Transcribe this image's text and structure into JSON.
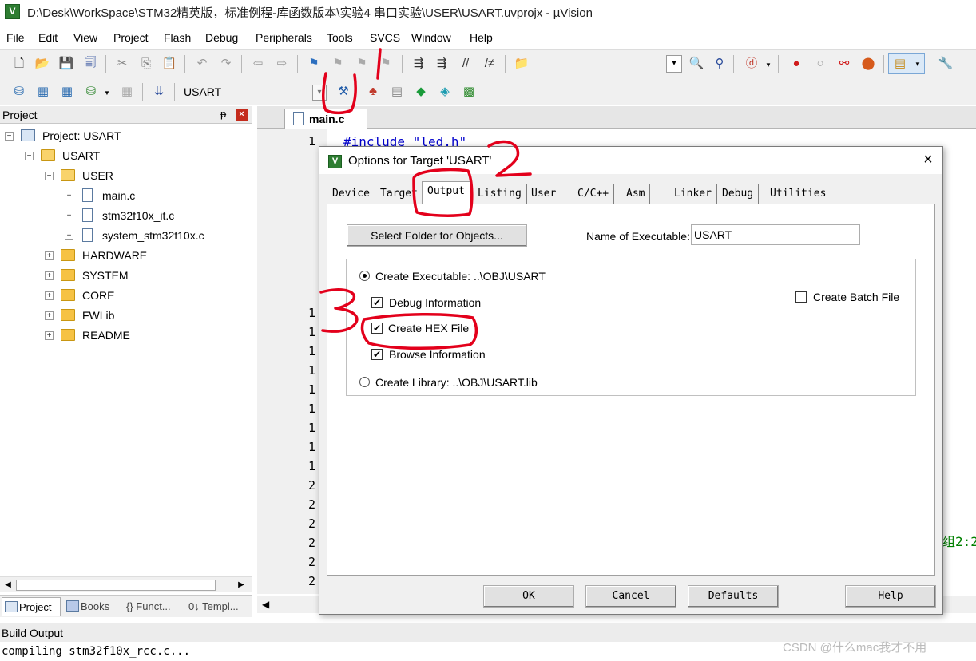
{
  "window": {
    "title": "D:\\Desk\\WorkSpace\\STM32精英版，标准例程-库函数版本\\实验4 串口实验\\USER\\USART.uvprojx - µVision",
    "icon": "uvision-app-icon"
  },
  "menu": [
    "File",
    "Edit",
    "View",
    "Project",
    "Flash",
    "Debug",
    "Peripherals",
    "Tools",
    "SVCS",
    "Window",
    "Help"
  ],
  "toolbar2": {
    "target": "USART"
  },
  "project_panel": {
    "title": "Project",
    "pin": "ᵽ",
    "close": "×",
    "tree": {
      "root": "Project: USART",
      "target": "USART",
      "group_open": "USER",
      "user_files": [
        "main.c",
        "stm32f10x_it.c",
        "system_stm32f10x.c"
      ],
      "groups": [
        "HARDWARE",
        "SYSTEM",
        "CORE",
        "FWLib",
        "README"
      ]
    },
    "tabs": [
      "Project",
      "Books",
      "{} Funct...",
      "0↓ Templ..."
    ]
  },
  "editor": {
    "tab": "main.c",
    "code_line_1": "#include \"led.h\"",
    "side_fragment": "组2:2",
    "line_numbers": [
      "1",
      "1",
      "1",
      "1",
      "1",
      "1",
      "1",
      "1",
      "1",
      "2",
      "2",
      "2",
      "2",
      "2",
      "2"
    ],
    "line_numbers_first": "1"
  },
  "build_output": {
    "title": "Build Output",
    "line": "compiling stm32f10x_rcc.c..."
  },
  "watermark": "CSDN @什么mac我才不用",
  "dialog": {
    "title": "Options for Target 'USART'",
    "close": "×",
    "tabs": [
      "Device",
      "Target",
      "Output",
      "Listing",
      "User",
      "C/C++",
      "Asm",
      "Linker",
      "Debug",
      "Utilities"
    ],
    "active_tab": "Output",
    "select_folder_button": "Select Folder for Objects...",
    "exe_label": "Name of Executable:",
    "exe_value": "USART",
    "create_executable_label": "Create Executable:  ..\\OBJ\\USART",
    "create_executable_checked": true,
    "debug_info_label": "Debug Information",
    "debug_info_checked": true,
    "create_hex_label": "Create HEX File",
    "create_hex_checked": true,
    "browse_info_label": "Browse Information",
    "browse_info_checked": true,
    "create_library_label": "Create Library:  ..\\OBJ\\USART.lib",
    "create_library_checked": false,
    "create_batch_label": "Create Batch File",
    "create_batch_checked": false,
    "buttons": {
      "ok": "OK",
      "cancel": "Cancel",
      "defaults": "Defaults",
      "help": "Help"
    },
    "check_mark": "✔"
  },
  "annotations": {
    "color": "#e3001b",
    "numbers": [
      "1",
      "2",
      "3"
    ]
  }
}
